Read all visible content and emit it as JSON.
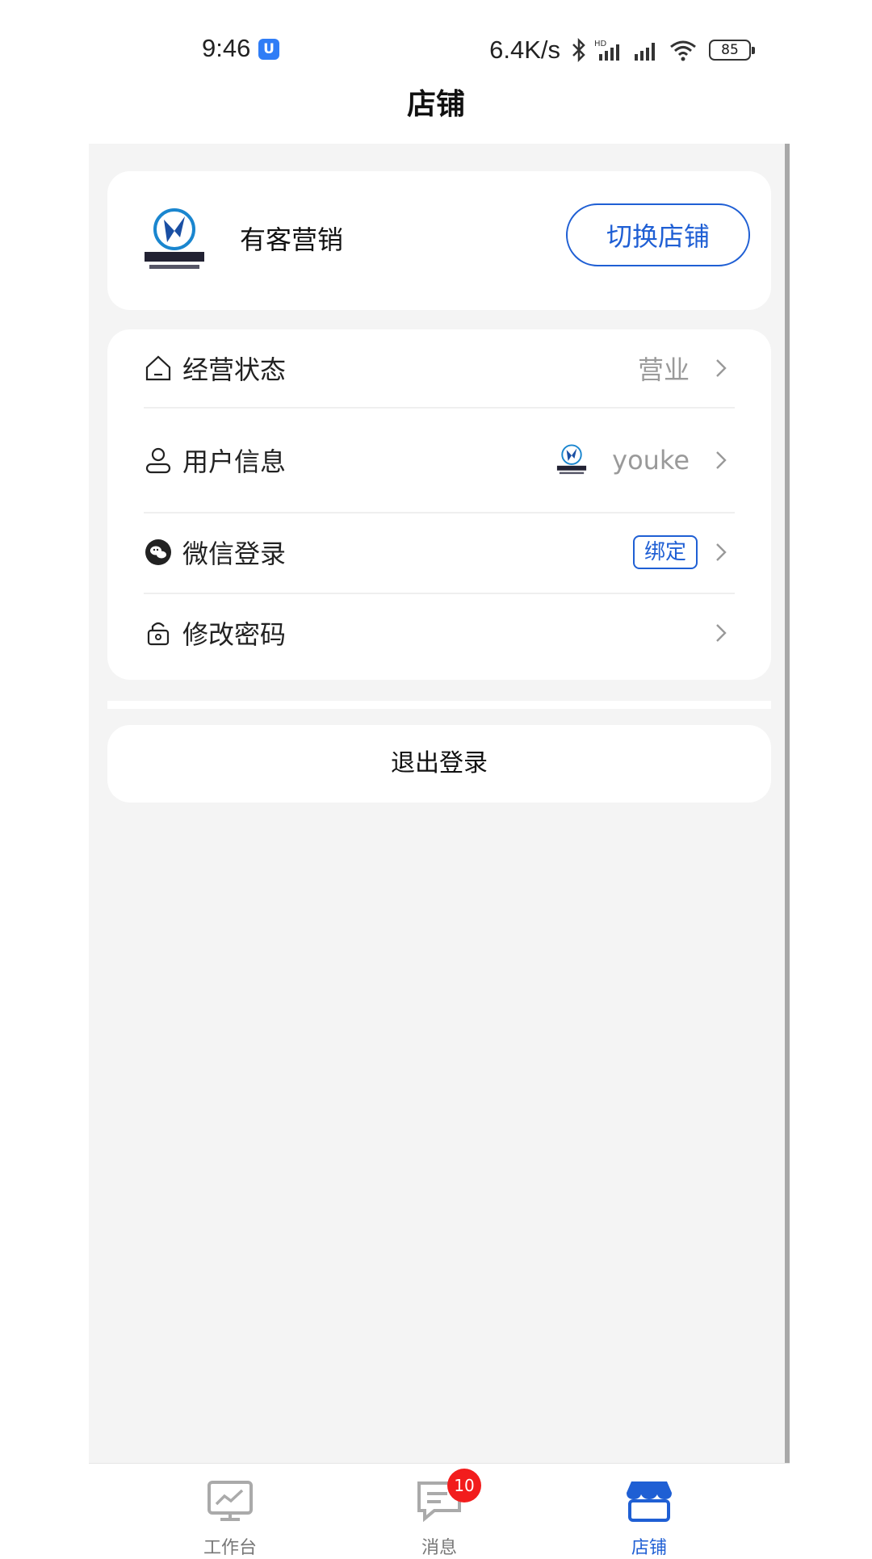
{
  "status_bar": {
    "time": "9:46",
    "app_icon": "shield-app-icon",
    "net_speed": "6.4K/s",
    "battery": "85",
    "icons": [
      "bluetooth-icon",
      "hd-signal-icon",
      "signal-icon",
      "wifi-icon",
      "battery-icon"
    ]
  },
  "header": {
    "title": "店铺"
  },
  "store": {
    "logo_icon": "youke-market-logo",
    "name": "有客营销",
    "switch_label": "切换店铺"
  },
  "menu": {
    "items": [
      {
        "icon": "home-icon",
        "label": "经营状态",
        "value": "营业"
      },
      {
        "icon": "user-icon",
        "label": "用户信息",
        "value": "youke",
        "avatar": "youke-market-logo"
      },
      {
        "icon": "wechat-icon",
        "label": "微信登录",
        "badge": "绑定"
      },
      {
        "icon": "lock-icon",
        "label": "修改密码"
      }
    ]
  },
  "logout_label": "退出登录",
  "tabbar": {
    "tabs": [
      {
        "icon": "monitor-chart-icon",
        "label": "工作台"
      },
      {
        "icon": "message-icon",
        "label": "消息",
        "badge": "10"
      },
      {
        "icon": "store-icon",
        "label": "店铺",
        "active": true
      }
    ]
  },
  "colors": {
    "accent": "#1f5fd4",
    "badge": "#f21d1d",
    "background": "#f4f4f4"
  }
}
